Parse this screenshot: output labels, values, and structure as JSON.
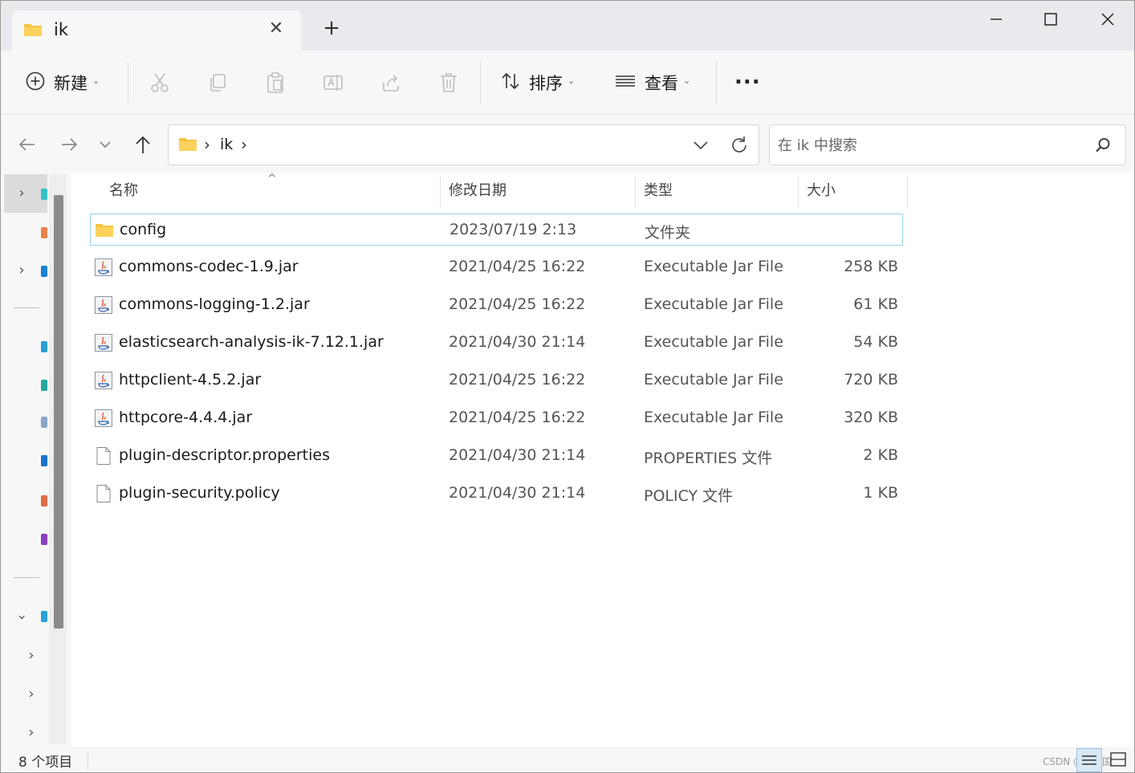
{
  "window": {
    "tab_title": "ik",
    "new_tab": "+"
  },
  "toolbar": {
    "new_label": "新建",
    "sort_label": "排序",
    "view_label": "查看",
    "more_label": "..."
  },
  "address": {
    "crumb": "ik",
    "search_placeholder": "在 ik 中搜索"
  },
  "columns": {
    "name": "名称",
    "date": "修改日期",
    "type": "类型",
    "size": "大小"
  },
  "files": [
    {
      "icon": "folder-icon",
      "name": "config",
      "date": "2023/07/19 2:13",
      "type": "文件夹",
      "size": ""
    },
    {
      "icon": "jar-file-icon",
      "name": "commons-codec-1.9.jar",
      "date": "2021/04/25 16:22",
      "type": "Executable Jar File",
      "size": "258 KB"
    },
    {
      "icon": "jar-file-icon",
      "name": "commons-logging-1.2.jar",
      "date": "2021/04/25 16:22",
      "type": "Executable Jar File",
      "size": "61 KB"
    },
    {
      "icon": "jar-file-icon",
      "name": "elasticsearch-analysis-ik-7.12.1.jar",
      "date": "2021/04/30 21:14",
      "type": "Executable Jar File",
      "size": "54 KB"
    },
    {
      "icon": "jar-file-icon",
      "name": "httpclient-4.5.2.jar",
      "date": "2021/04/25 16:22",
      "type": "Executable Jar File",
      "size": "720 KB"
    },
    {
      "icon": "jar-file-icon",
      "name": "httpcore-4.4.4.jar",
      "date": "2021/04/25 16:22",
      "type": "Executable Jar File",
      "size": "320 KB"
    },
    {
      "icon": "document-file-icon",
      "name": "plugin-descriptor.properties",
      "date": "2021/04/30 21:14",
      "type": "PROPERTIES 文件",
      "size": "2 KB"
    },
    {
      "icon": "document-file-icon",
      "name": "plugin-security.policy",
      "date": "2021/04/30 21:14",
      "type": "POLICY 文件",
      "size": "1 KB"
    }
  ],
  "status": {
    "item_count": "8 个项目",
    "watermark": "CSDN @吕宜国"
  },
  "colors": {
    "folder": "#f6c342",
    "selection_border": "#99d1e8",
    "chrome_bg": "#f7f7f7",
    "titlebar_bg": "#e9eaed"
  }
}
